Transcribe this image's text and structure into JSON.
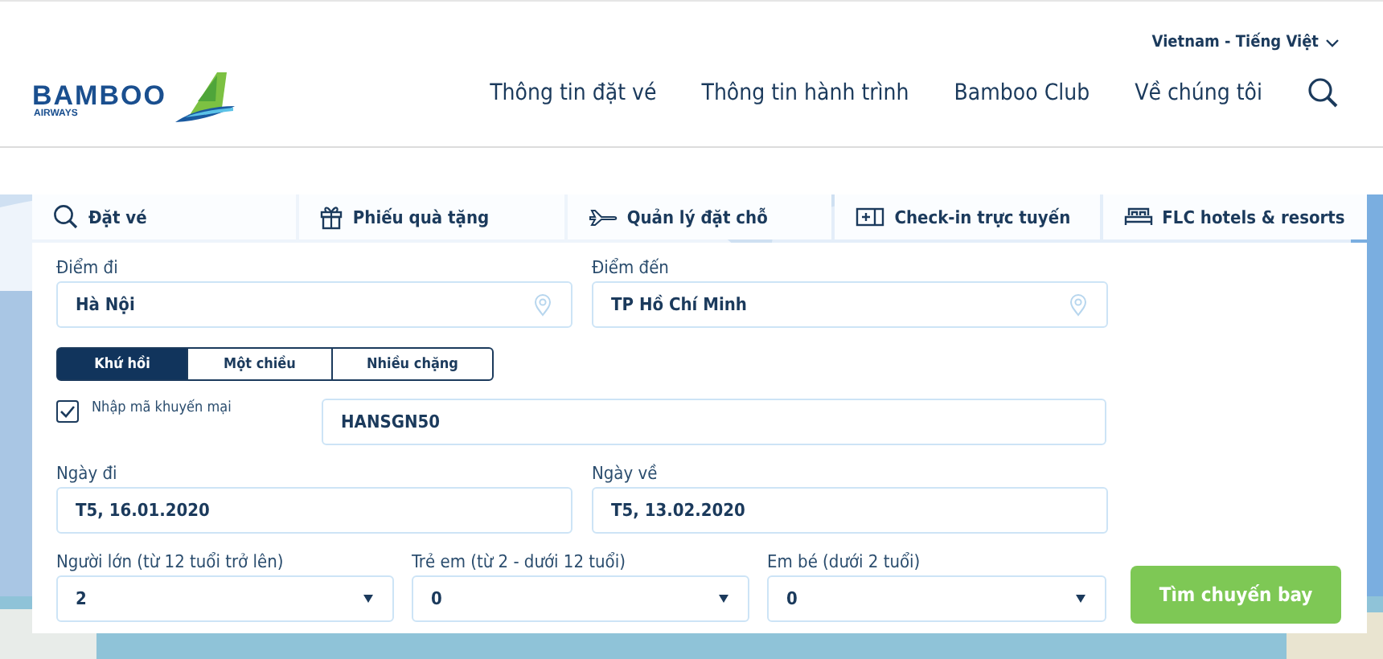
{
  "language_selector": "Vietnam - Tiếng Việt",
  "logo": {
    "name": "BAMBOO",
    "tagline": "AIRWAYS"
  },
  "nav": [
    "Thông tin đặt vé",
    "Thông tin hành trình",
    "Bamboo Club",
    "Về chúng tôi"
  ],
  "tabs": [
    {
      "label": "Đặt vé",
      "kind": "search"
    },
    {
      "label": "Phiếu quà tặng",
      "kind": "gift"
    },
    {
      "label": "Quản lý đặt chỗ",
      "kind": "plane"
    },
    {
      "label": "Check-in trực tuyến",
      "kind": "ticket"
    },
    {
      "label": "FLC hotels & resorts",
      "kind": "bed"
    }
  ],
  "form": {
    "origin": {
      "label": "Điểm đi",
      "value": "Hà Nội"
    },
    "destination": {
      "label": "Điểm đến",
      "value": "TP Hồ Chí Minh"
    },
    "trip_types": [
      {
        "label": "Khứ hồi",
        "selected": true
      },
      {
        "label": "Một chiều",
        "selected": false
      },
      {
        "label": "Nhiều chặng",
        "selected": false
      }
    ],
    "promo": {
      "label": "Nhập mã khuyến mại",
      "checked": true,
      "value": "HANSGN50"
    },
    "depart_date": {
      "label": "Ngày đi",
      "value": "T5, 16.01.2020"
    },
    "return_date": {
      "label": "Ngày về",
      "value": "T5, 13.02.2020"
    },
    "passengers": [
      {
        "label": "Người lớn (từ 12 tuổi trở lên)",
        "value": "2"
      },
      {
        "label": "Trẻ em (từ 2 - dưới 12 tuổi)",
        "value": "0"
      },
      {
        "label": "Em bé (dưới 2 tuổi)",
        "value": "0"
      }
    ],
    "search_button": "Tìm chuyến bay"
  }
}
